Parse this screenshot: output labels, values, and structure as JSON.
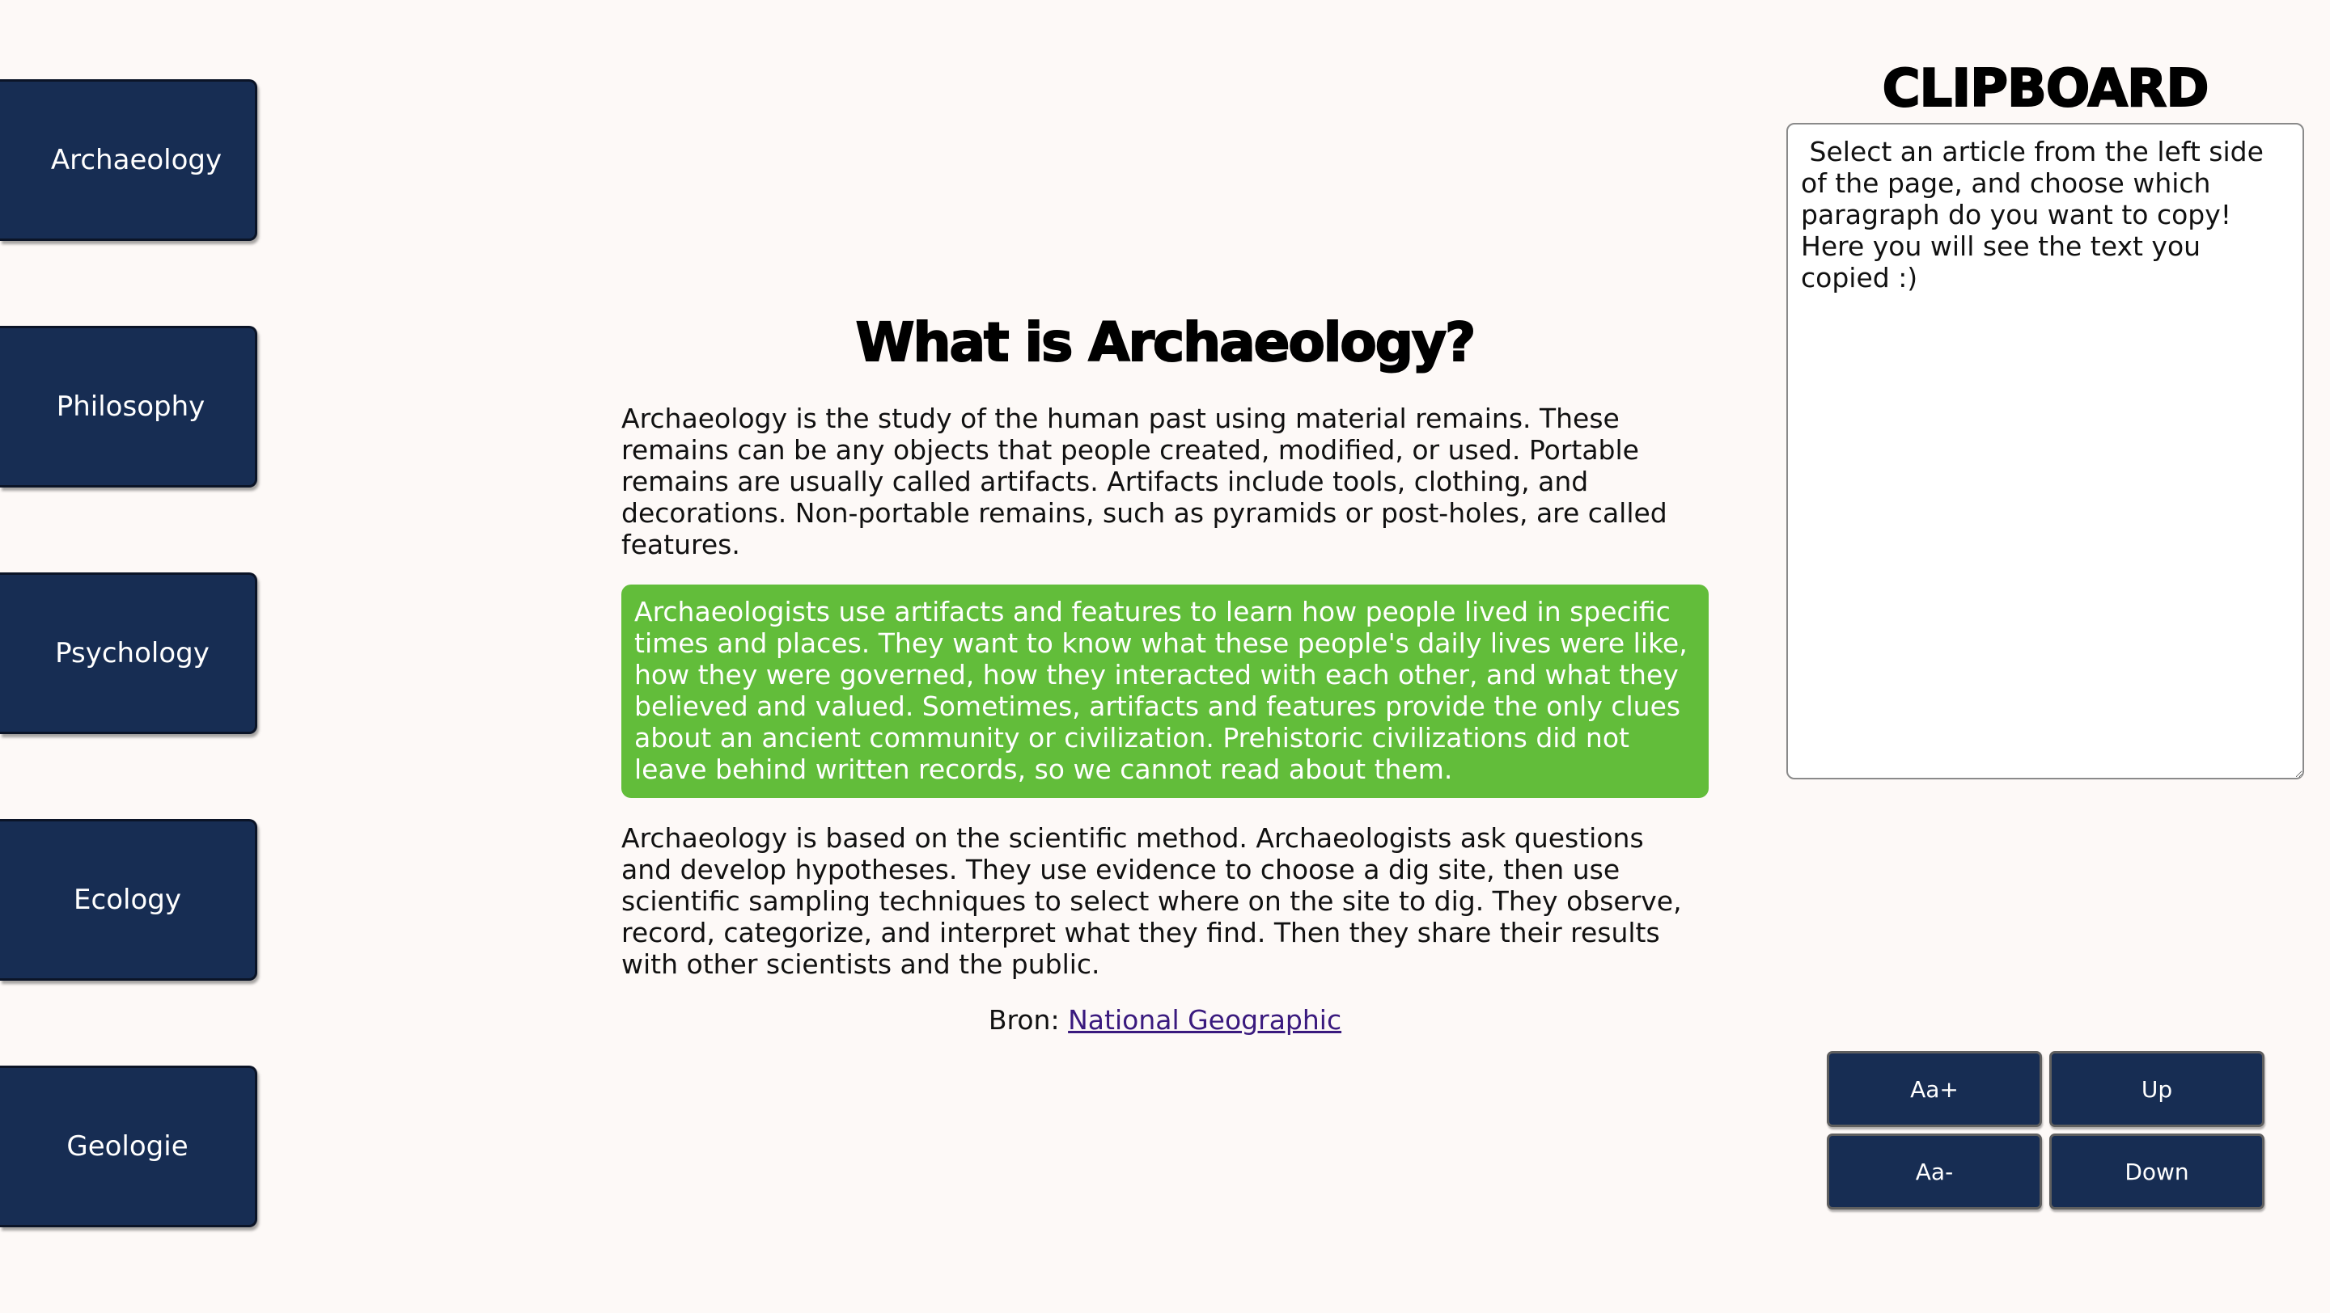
{
  "sidebar": {
    "items": [
      {
        "label": "Archaeology"
      },
      {
        "label": "Philosophy"
      },
      {
        "label": "Psychology"
      },
      {
        "label": "Ecology"
      },
      {
        "label": "Geologie"
      }
    ]
  },
  "article": {
    "title": "What is Archaeology?",
    "paragraphs": [
      "Archaeology is the study of the human past using material remains. These remains can be any objects that people created, modified, or used. Portable remains are usually called artifacts. Artifacts include tools, clothing, and decorations. Non-portable remains, such as pyramids or post-holes, are called features.",
      "Archaeologists use artifacts and features to learn how people lived in specific times and places. They want to know what these people's daily lives were like, how they were governed, how they interacted with each other, and what they believed and valued. Sometimes, artifacts and features provide the only clues about an ancient community or civilization. Prehistoric civilizations did not leave behind written records, so we cannot read about them.",
      "Archaeology is based on the scientific method. Archaeologists ask questions and develop hypotheses. They use evidence to choose a dig site, then use scientific sampling techniques to select where on the site to dig. They observe, record, categorize, and interpret what they find. Then they share their results with other scientists and the public."
    ],
    "selected_paragraph": 2,
    "source_label": "Bron:",
    "source_link": "National Geographic"
  },
  "clipboard": {
    "title": "CLIPBOARD",
    "text": " Select an article from the left side of the page, and choose which paragraph do you want to copy! Here you will see the text you copied :)"
  },
  "controls": {
    "font_increase": "Aa+",
    "font_decrease": "Aa-",
    "up": "Up",
    "down": "Down"
  },
  "colors": {
    "background": "#fdf9f7",
    "button_navy": "#172d53",
    "selected_green": "#62bd3a",
    "link_purple": "#3a1a7e"
  }
}
